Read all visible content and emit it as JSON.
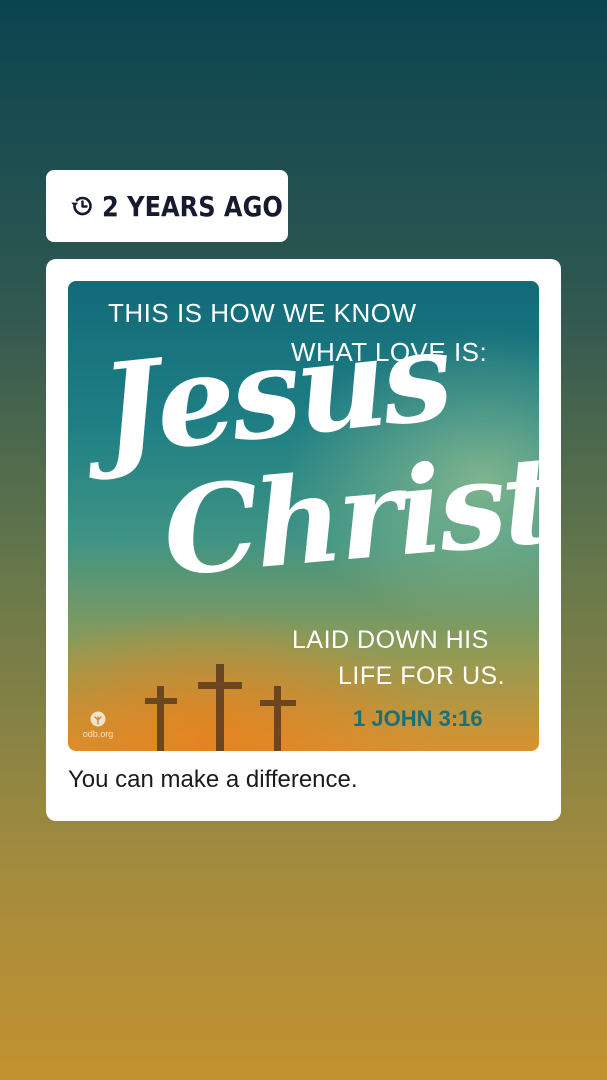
{
  "memory": {
    "label": "2 YEARS AGO",
    "icon": "history-icon"
  },
  "post": {
    "image": {
      "line1": "THIS IS HOW WE KNOW",
      "line2": "WHAT LOVE IS:",
      "script1": "Jesus",
      "script2": "Christ",
      "line3": "LAID DOWN HIS",
      "line4": "LIFE FOR US.",
      "reference": "1 JOHN 3:16",
      "watermark": "odb.org"
    },
    "caption": "You can make a difference."
  },
  "colors": {
    "reference_teal": "#1d6f73",
    "badge_text": "#151a2e"
  }
}
